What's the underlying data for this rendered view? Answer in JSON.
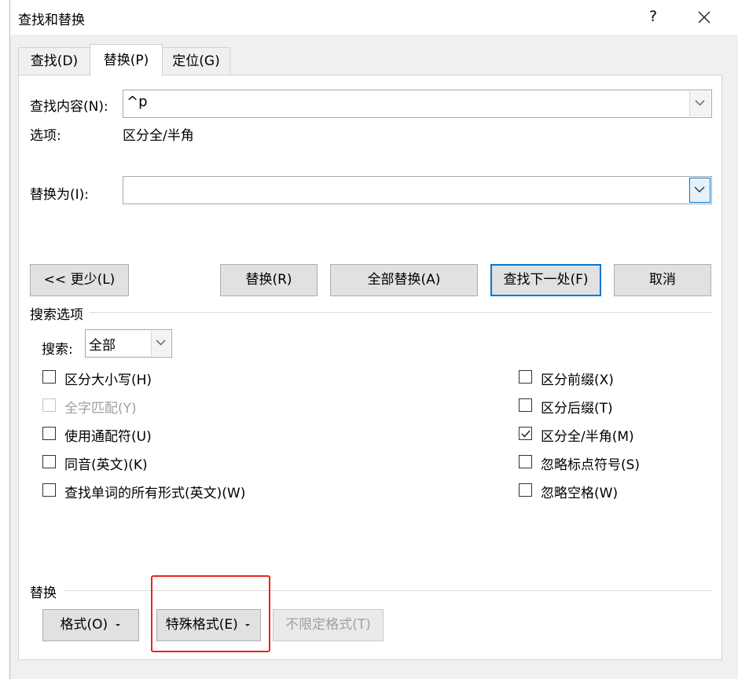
{
  "window": {
    "title": "查找和替换",
    "help": "?"
  },
  "tabs": [
    {
      "label": "查找(D)"
    },
    {
      "label": "替换(P)"
    },
    {
      "label": "定位(G)"
    }
  ],
  "find": {
    "label": "查找内容(N):",
    "value": "^p",
    "options_label": "选项:",
    "options_value": "区分全/半角"
  },
  "replace": {
    "label": "替换为(I):",
    "value": ""
  },
  "buttons": {
    "less": "<< 更少(L)",
    "replace": "替换(R)",
    "replace_all": "全部替换(A)",
    "find_next": "查找下一处(F)",
    "cancel": "取消"
  },
  "search_options": {
    "section_label": "搜索选项",
    "search_label": "搜索:",
    "search_value": "全部",
    "left": [
      {
        "label": "区分大小写(H)",
        "checked": false,
        "enabled": true
      },
      {
        "label": "全字匹配(Y)",
        "checked": false,
        "enabled": false
      },
      {
        "label": "使用通配符(U)",
        "checked": false,
        "enabled": true
      },
      {
        "label": "同音(英文)(K)",
        "checked": false,
        "enabled": true
      },
      {
        "label": "查找单词的所有形式(英文)(W)",
        "checked": false,
        "enabled": true
      }
    ],
    "right": [
      {
        "label": "区分前缀(X)",
        "checked": false,
        "enabled": true
      },
      {
        "label": "区分后缀(T)",
        "checked": false,
        "enabled": true
      },
      {
        "label": "区分全/半角(M)",
        "checked": true,
        "enabled": true
      },
      {
        "label": "忽略标点符号(S)",
        "checked": false,
        "enabled": true
      },
      {
        "label": "忽略空格(W)",
        "checked": false,
        "enabled": true
      }
    ]
  },
  "replace_section": {
    "label": "替换",
    "format": "格式(O)",
    "special": "特殊格式(E)",
    "no_format": "不限定格式(T)"
  },
  "colors": {
    "accent": "#0078d7",
    "highlight": "#e8241a"
  }
}
